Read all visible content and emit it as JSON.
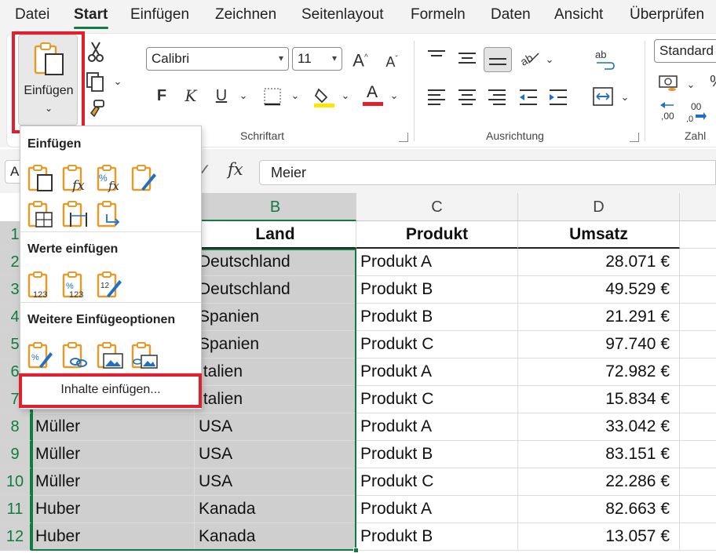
{
  "menu": {
    "tabs": [
      {
        "label": "Datei"
      },
      {
        "label": "Start"
      },
      {
        "label": "Einfügen"
      },
      {
        "label": "Zeichnen"
      },
      {
        "label": "Seitenlayout"
      },
      {
        "label": "Formeln"
      },
      {
        "label": "Daten"
      },
      {
        "label": "Ansicht"
      },
      {
        "label": "Überprüfen"
      }
    ],
    "active_tab": "Start"
  },
  "ribbon": {
    "clipboard": {
      "paste_label": "Einfügen"
    },
    "font": {
      "group_label": "Schriftart",
      "font_name": "Calibri",
      "font_size": "11",
      "bold": "F",
      "italic": "K",
      "underline": "U",
      "font_color_letter": "A"
    },
    "alignment": {
      "group_label": "Ausrichtung"
    },
    "number": {
      "group_label": "Zahl",
      "format": "Standard"
    }
  },
  "formula_bar": {
    "name_box": "A",
    "fx_label": "fx",
    "value": "Meier"
  },
  "sheet": {
    "columns": [
      "B",
      "C",
      "D"
    ],
    "row_numbers": [
      "1",
      "2",
      "3",
      "4",
      "5",
      "6",
      "7",
      "8",
      "9",
      "10",
      "11",
      "12"
    ],
    "header_row": {
      "land": "Land",
      "produkt": "Produkt",
      "umsatz": "Umsatz"
    },
    "rows": [
      {
        "name": "",
        "land": "Deutschland",
        "produkt": "Produkt A",
        "umsatz": "28.071 €"
      },
      {
        "name": "",
        "land": "Deutschland",
        "produkt": "Produkt B",
        "umsatz": "49.529 €"
      },
      {
        "name": "",
        "land": "Spanien",
        "produkt": "Produkt B",
        "umsatz": "21.291 €"
      },
      {
        "name": "",
        "land": "Spanien",
        "produkt": "Produkt C",
        "umsatz": "97.740 €"
      },
      {
        "name": "",
        "land": "Italien",
        "produkt": "Produkt A",
        "umsatz": "72.982 €"
      },
      {
        "name": "",
        "land": "Italien",
        "produkt": "Produkt C",
        "umsatz": "15.834 €"
      },
      {
        "name": "Müller",
        "land": "USA",
        "produkt": "Produkt A",
        "umsatz": "33.042 €"
      },
      {
        "name": "Müller",
        "land": "USA",
        "produkt": "Produkt B",
        "umsatz": "83.151 €"
      },
      {
        "name": "Müller",
        "land": "USA",
        "produkt": "Produkt C",
        "umsatz": "22.286 €"
      },
      {
        "name": "Huber",
        "land": "Kanada",
        "produkt": "Produkt A",
        "umsatz": "82.663 €"
      },
      {
        "name": "Huber",
        "land": "Kanada",
        "produkt": "Produkt B",
        "umsatz": "13.057 €"
      }
    ]
  },
  "paste_menu": {
    "section_paste": "Einfügen",
    "section_values": "Werte einfügen",
    "section_more": "Weitere Einfügeoptionen",
    "paste_special": "Inhalte einfügen..."
  },
  "colors": {
    "accent_green": "#107c41",
    "highlight_red": "#e0202e",
    "selection_gray": "#cfcfcf"
  }
}
